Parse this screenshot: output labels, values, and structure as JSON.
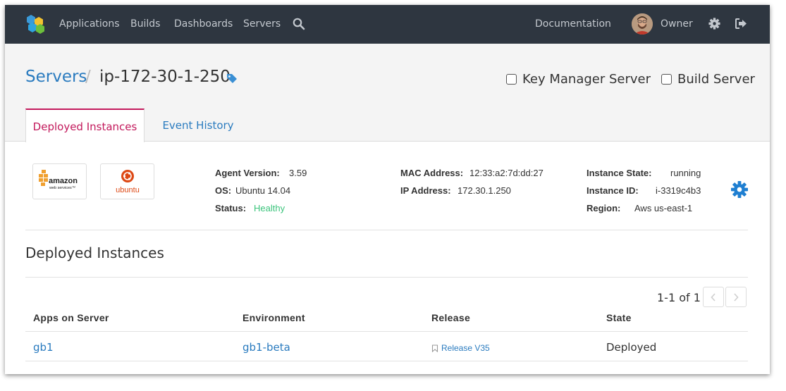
{
  "nav": {
    "links": [
      "Applications",
      "Builds",
      "Dashboards",
      "Servers"
    ],
    "documentation": "Documentation",
    "user": "Owner"
  },
  "breadcrumb": {
    "parent": "Servers",
    "separator": "/",
    "current": "ip-172-30-1-250"
  },
  "options": {
    "key_manager": "Key Manager Server",
    "build_server": "Build Server"
  },
  "tabs": {
    "active": "Deployed Instances",
    "inactive": "Event History"
  },
  "badges": {
    "aws_text": "amazon",
    "aws_sub": "web services™",
    "ubuntu_text": "ubuntu"
  },
  "info": {
    "agent_version_label": "Agent Version:",
    "agent_version": "3.59",
    "os_label": "OS:",
    "os": "Ubuntu 14.04",
    "status_label": "Status:",
    "status": "Healthy",
    "mac_label": "MAC Address:",
    "mac": "12:33:a2:7d:dd:27",
    "ip_label": "IP Address:",
    "ip": "172.30.1.250",
    "state_label": "Instance State:",
    "state": "running",
    "id_label": "Instance ID:",
    "id": "i-3319c4b3",
    "region_label": "Region:",
    "region": "Aws us-east-1"
  },
  "section": {
    "title": "Deployed Instances"
  },
  "pager": {
    "text": "1-1 of 1"
  },
  "table": {
    "headers": [
      "Apps on Server",
      "Environment",
      "Release",
      "State"
    ],
    "rows": [
      {
        "app": "gb1",
        "environment": "gb1-beta",
        "release": "Release V35",
        "state": "Deployed"
      }
    ]
  },
  "colors": {
    "nav_bg": "#2e3640",
    "link": "#2a7bbf",
    "active_tab": "#c2185b",
    "healthy": "#3cc47c"
  }
}
